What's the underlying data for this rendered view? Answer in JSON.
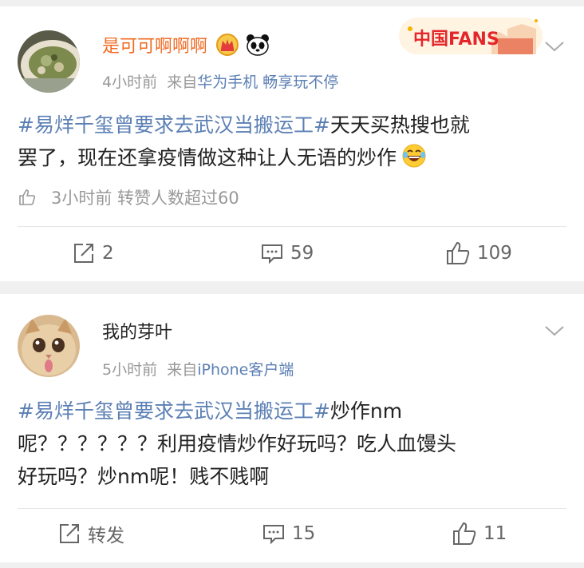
{
  "posts": [
    {
      "username": "是可可啊啊啊",
      "time": "4小时前",
      "via": "来自",
      "source": "华为手机 畅享玩不停",
      "topic": "#易烊千玺曾要求去武汉当搬运工#",
      "text_line1": "天天买热搜也就",
      "text_line2": "罢了，现在还拿疫情做这种让人无语的炒作",
      "emoji_icon": "laugh-cry-emoji",
      "like_line": "3小时前 转赞人数超过60",
      "actions": {
        "repost": "2",
        "comment": "59",
        "like": "109"
      },
      "badge": "中国FANS"
    },
    {
      "username": "我的芽叶",
      "time": "5小时前",
      "via": "来自",
      "source": "iPhone客户端",
      "topic": "#易烊千玺曾要求去武汉当搬运工#",
      "text_line1": "炒作nm",
      "text_line2": "呢？？？？？？利用疫情炒作好玩吗？吃人血馒头",
      "text_line3": "好玩吗？炒nm呢！贱不贱啊",
      "actions": {
        "repost": "转发",
        "comment": "15",
        "like": "11"
      }
    }
  ],
  "colors": {
    "username_orange": "#f06a22",
    "link_blue": "#5b7fb4",
    "text": "#222222",
    "muted": "#999999"
  }
}
